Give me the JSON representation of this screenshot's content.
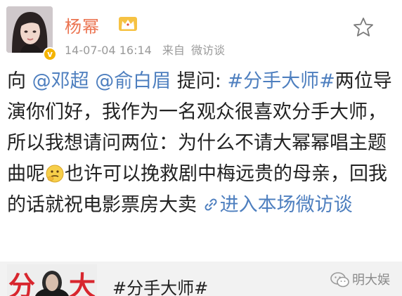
{
  "post": {
    "author": "杨幂",
    "timestamp": "14-07-04 16:14",
    "source_prefix": "来自",
    "source": "微访谈",
    "verified_mark": "v",
    "content": {
      "prefix": "向 ",
      "mention_1": "@邓超",
      "space_1": " ",
      "mention_2": "@俞白眉",
      "mid_1": " 提问: ",
      "hashtag": "#分手大师#",
      "body_1": "两位导演你们好，我作为一名观众很喜欢分手大师，所以我想请问两位：为什么不请大幂幂唱主题曲呢",
      "body_2": "也许可以挽救剧中梅远贵的母亲，回我的话就祝电影票房大卖 ",
      "link_text": "进入本场微访谈"
    }
  },
  "topic_card": {
    "poster_chars": [
      "分",
      "大"
    ],
    "title": "#分手大师#"
  },
  "watermark": {
    "text": "明大娱"
  },
  "colors": {
    "username": "#eb7350",
    "link": "#4e7fbf",
    "meta": "#9a9a9a",
    "body": "#222222",
    "card_bg": "#f2f2f2",
    "badge": "#f4b400",
    "poster_red": "#d8262e"
  },
  "icons": {
    "crown": "crown-icon",
    "star": "star-icon",
    "emoji": "thinking-emoji-icon",
    "chain": "link-chain-icon",
    "wechat": "wechat-icon"
  }
}
